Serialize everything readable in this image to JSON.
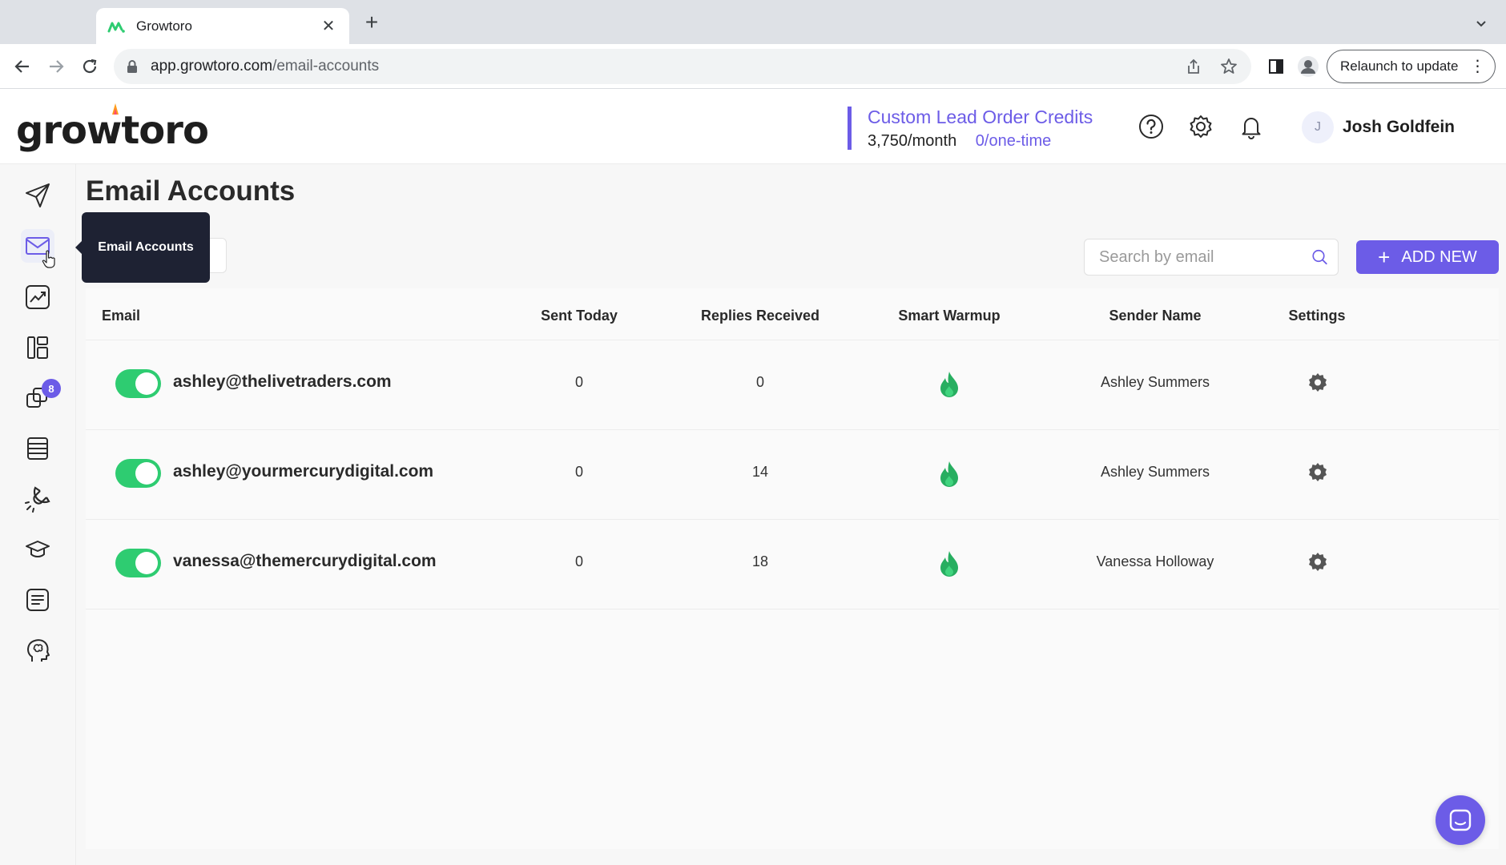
{
  "browser": {
    "tab_title": "Growtoro",
    "url_host": "app.growtoro.com",
    "url_path": "/email-accounts",
    "relaunch_label": "Relaunch to update"
  },
  "header": {
    "logo_text": "growtoro",
    "credits_title": "Custom Lead Order Credits",
    "credits_monthly": "3,750/month",
    "credits_onetime": "0/one-time",
    "user_initial": "J",
    "user_name": "Josh Goldfein"
  },
  "sidebar": {
    "items": [
      "campaigns",
      "email-accounts",
      "analytics",
      "templates",
      "integrations",
      "leads-database",
      "magnet",
      "academy",
      "notes",
      "ai-brain"
    ],
    "badge_count": "8",
    "tooltip": "Email Accounts"
  },
  "main": {
    "title": "Email Accounts",
    "search_placeholder": "Search by email",
    "add_new_label": "ADD NEW"
  },
  "table": {
    "headers": {
      "email": "Email",
      "sent_today": "Sent Today",
      "replies": "Replies Received",
      "warmup": "Smart Warmup",
      "sender": "Sender Name",
      "settings": "Settings"
    },
    "rows": [
      {
        "email": "ashley@thelivetraders.com",
        "sent_today": "0",
        "replies": "0",
        "sender": "Ashley Summers",
        "enabled": true
      },
      {
        "email": "ashley@yourmercurydigital.com",
        "sent_today": "0",
        "replies": "14",
        "sender": "Ashley Summers",
        "enabled": true
      },
      {
        "email": "vanessa@themercurydigital.com",
        "sent_today": "0",
        "replies": "18",
        "sender": "Vanessa Holloway",
        "enabled": true
      }
    ]
  },
  "colors": {
    "accent": "#6c5ce7",
    "toggle_on": "#2ecc71",
    "flame": "#27ae60"
  }
}
